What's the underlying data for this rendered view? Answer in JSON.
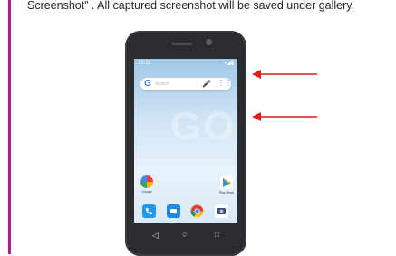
{
  "caption": "Screenshot” . All captured screenshot will be saved under gallery.",
  "phone": {
    "status_time": "10:11",
    "search_placeholder": "Search",
    "home_apps": [
      {
        "label": "Google"
      },
      {
        "label": "Play Store"
      }
    ],
    "dock_icons": [
      "phone-icon",
      "messages-icon",
      "chrome-icon",
      "camera-icon"
    ],
    "nav": [
      "back",
      "home",
      "recents"
    ]
  },
  "colors": {
    "accent_bar": "#b5179e",
    "arrow": "#e01b1b"
  }
}
